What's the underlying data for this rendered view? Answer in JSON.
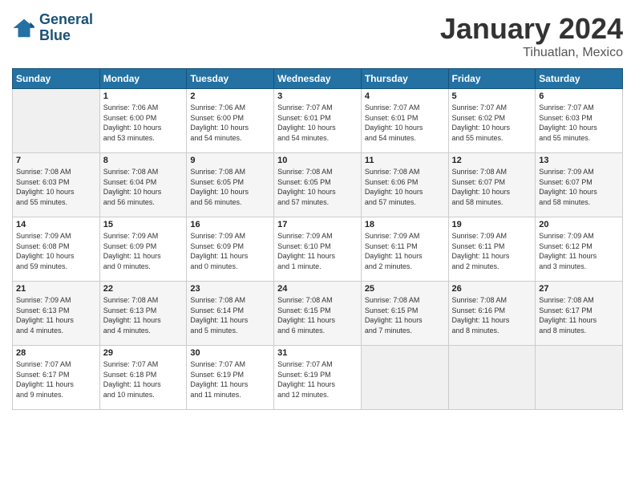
{
  "header": {
    "logo_line1": "General",
    "logo_line2": "Blue",
    "title": "January 2024",
    "subtitle": "Tihuatlan, Mexico"
  },
  "days_of_week": [
    "Sunday",
    "Monday",
    "Tuesday",
    "Wednesday",
    "Thursday",
    "Friday",
    "Saturday"
  ],
  "weeks": [
    [
      {
        "num": "",
        "info": ""
      },
      {
        "num": "1",
        "info": "Sunrise: 7:06 AM\nSunset: 6:00 PM\nDaylight: 10 hours\nand 53 minutes."
      },
      {
        "num": "2",
        "info": "Sunrise: 7:06 AM\nSunset: 6:00 PM\nDaylight: 10 hours\nand 54 minutes."
      },
      {
        "num": "3",
        "info": "Sunrise: 7:07 AM\nSunset: 6:01 PM\nDaylight: 10 hours\nand 54 minutes."
      },
      {
        "num": "4",
        "info": "Sunrise: 7:07 AM\nSunset: 6:01 PM\nDaylight: 10 hours\nand 54 minutes."
      },
      {
        "num": "5",
        "info": "Sunrise: 7:07 AM\nSunset: 6:02 PM\nDaylight: 10 hours\nand 55 minutes."
      },
      {
        "num": "6",
        "info": "Sunrise: 7:07 AM\nSunset: 6:03 PM\nDaylight: 10 hours\nand 55 minutes."
      }
    ],
    [
      {
        "num": "7",
        "info": "Sunrise: 7:08 AM\nSunset: 6:03 PM\nDaylight: 10 hours\nand 55 minutes."
      },
      {
        "num": "8",
        "info": "Sunrise: 7:08 AM\nSunset: 6:04 PM\nDaylight: 10 hours\nand 56 minutes."
      },
      {
        "num": "9",
        "info": "Sunrise: 7:08 AM\nSunset: 6:05 PM\nDaylight: 10 hours\nand 56 minutes."
      },
      {
        "num": "10",
        "info": "Sunrise: 7:08 AM\nSunset: 6:05 PM\nDaylight: 10 hours\nand 57 minutes."
      },
      {
        "num": "11",
        "info": "Sunrise: 7:08 AM\nSunset: 6:06 PM\nDaylight: 10 hours\nand 57 minutes."
      },
      {
        "num": "12",
        "info": "Sunrise: 7:08 AM\nSunset: 6:07 PM\nDaylight: 10 hours\nand 58 minutes."
      },
      {
        "num": "13",
        "info": "Sunrise: 7:09 AM\nSunset: 6:07 PM\nDaylight: 10 hours\nand 58 minutes."
      }
    ],
    [
      {
        "num": "14",
        "info": "Sunrise: 7:09 AM\nSunset: 6:08 PM\nDaylight: 10 hours\nand 59 minutes."
      },
      {
        "num": "15",
        "info": "Sunrise: 7:09 AM\nSunset: 6:09 PM\nDaylight: 11 hours\nand 0 minutes."
      },
      {
        "num": "16",
        "info": "Sunrise: 7:09 AM\nSunset: 6:09 PM\nDaylight: 11 hours\nand 0 minutes."
      },
      {
        "num": "17",
        "info": "Sunrise: 7:09 AM\nSunset: 6:10 PM\nDaylight: 11 hours\nand 1 minute."
      },
      {
        "num": "18",
        "info": "Sunrise: 7:09 AM\nSunset: 6:11 PM\nDaylight: 11 hours\nand 2 minutes."
      },
      {
        "num": "19",
        "info": "Sunrise: 7:09 AM\nSunset: 6:11 PM\nDaylight: 11 hours\nand 2 minutes."
      },
      {
        "num": "20",
        "info": "Sunrise: 7:09 AM\nSunset: 6:12 PM\nDaylight: 11 hours\nand 3 minutes."
      }
    ],
    [
      {
        "num": "21",
        "info": "Sunrise: 7:09 AM\nSunset: 6:13 PM\nDaylight: 11 hours\nand 4 minutes."
      },
      {
        "num": "22",
        "info": "Sunrise: 7:08 AM\nSunset: 6:13 PM\nDaylight: 11 hours\nand 4 minutes."
      },
      {
        "num": "23",
        "info": "Sunrise: 7:08 AM\nSunset: 6:14 PM\nDaylight: 11 hours\nand 5 minutes."
      },
      {
        "num": "24",
        "info": "Sunrise: 7:08 AM\nSunset: 6:15 PM\nDaylight: 11 hours\nand 6 minutes."
      },
      {
        "num": "25",
        "info": "Sunrise: 7:08 AM\nSunset: 6:15 PM\nDaylight: 11 hours\nand 7 minutes."
      },
      {
        "num": "26",
        "info": "Sunrise: 7:08 AM\nSunset: 6:16 PM\nDaylight: 11 hours\nand 8 minutes."
      },
      {
        "num": "27",
        "info": "Sunrise: 7:08 AM\nSunset: 6:17 PM\nDaylight: 11 hours\nand 8 minutes."
      }
    ],
    [
      {
        "num": "28",
        "info": "Sunrise: 7:07 AM\nSunset: 6:17 PM\nDaylight: 11 hours\nand 9 minutes."
      },
      {
        "num": "29",
        "info": "Sunrise: 7:07 AM\nSunset: 6:18 PM\nDaylight: 11 hours\nand 10 minutes."
      },
      {
        "num": "30",
        "info": "Sunrise: 7:07 AM\nSunset: 6:19 PM\nDaylight: 11 hours\nand 11 minutes."
      },
      {
        "num": "31",
        "info": "Sunrise: 7:07 AM\nSunset: 6:19 PM\nDaylight: 11 hours\nand 12 minutes."
      },
      {
        "num": "",
        "info": ""
      },
      {
        "num": "",
        "info": ""
      },
      {
        "num": "",
        "info": ""
      }
    ]
  ]
}
